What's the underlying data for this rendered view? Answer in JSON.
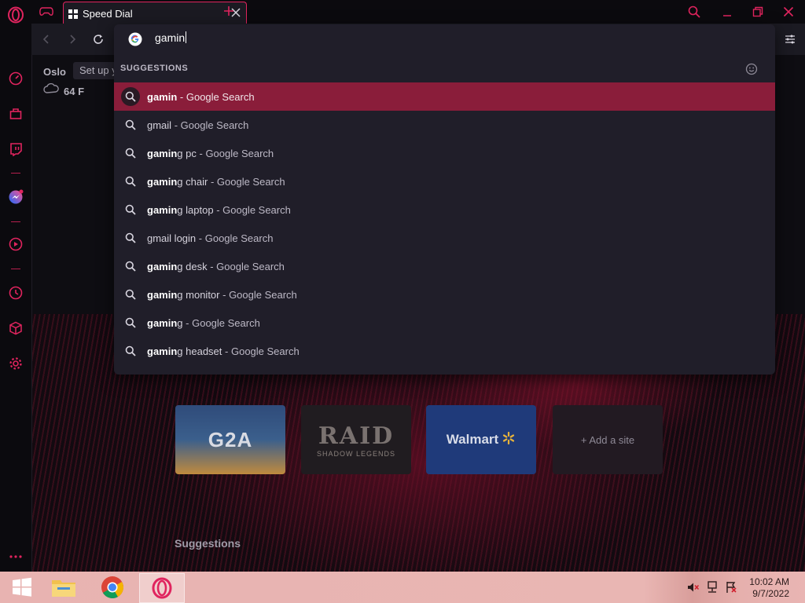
{
  "browser": {
    "tab_title": "Speed Dial",
    "omnibox_value": "gamin"
  },
  "weather": {
    "city": "Oslo",
    "setup_label": "Set up y",
    "temperature": "64 F"
  },
  "dropdown": {
    "header": "SUGGESTIONS",
    "suggestions": [
      {
        "bold": "gamin",
        "rest": "",
        "suffix": "- Google Search"
      },
      {
        "bold": "",
        "rest": "gmail",
        "suffix": "- Google Search"
      },
      {
        "bold": "gamin",
        "rest": "g pc",
        "suffix": "- Google Search"
      },
      {
        "bold": "gamin",
        "rest": "g chair",
        "suffix": "- Google Search"
      },
      {
        "bold": "gamin",
        "rest": "g laptop",
        "suffix": "- Google Search"
      },
      {
        "bold": "",
        "rest": "gmail login",
        "suffix": "- Google Search"
      },
      {
        "bold": "gamin",
        "rest": "g desk",
        "suffix": "- Google Search"
      },
      {
        "bold": "gamin",
        "rest": "g monitor",
        "suffix": "- Google Search"
      },
      {
        "bold": "gamin",
        "rest": "g",
        "suffix": "- Google Search"
      },
      {
        "bold": "gamin",
        "rest": "g headset",
        "suffix": "- Google Search"
      }
    ]
  },
  "speed_dial": {
    "sites": [
      {
        "label": "G2A"
      },
      {
        "label": "RAID",
        "sub": "SHADOW LEGENDS"
      },
      {
        "label": "Walmart"
      },
      {
        "label": "+ Add a site"
      }
    ],
    "suggestions_heading": "Suggestions"
  },
  "taskbar": {
    "time": "10:02 AM",
    "date": "9/7/2022"
  },
  "colors": {
    "accent": "#e0245e",
    "active_row": "#8a1d3a",
    "dropdown_bg": "#201e29"
  }
}
